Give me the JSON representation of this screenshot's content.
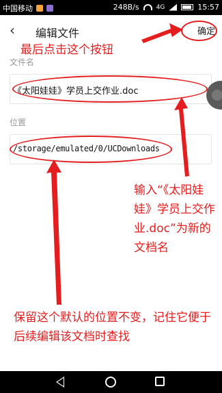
{
  "status_bar": {
    "carrier": "中国移动",
    "speed": "248B/s",
    "network": "4G",
    "time": "15:57"
  },
  "header": {
    "title": "编辑文件",
    "confirm_label": "确定",
    "back_icon": "‹"
  },
  "filename_section": {
    "label": "文件名",
    "value": "《太阳娃娃》学员上交作业.doc"
  },
  "location_section": {
    "label": "位置",
    "value": "/storage/emulated/0/UCDownloads"
  },
  "annotations": {
    "top": "最后点击这个按钮",
    "right": "输入“《太阳娃娃》学员上交作业.doc”为新的文档名",
    "bottom": "保留这个默认的位置不变，记住它便于后续编辑该文档时查找"
  },
  "colors": {
    "annotation_red": "#e41e1e"
  }
}
